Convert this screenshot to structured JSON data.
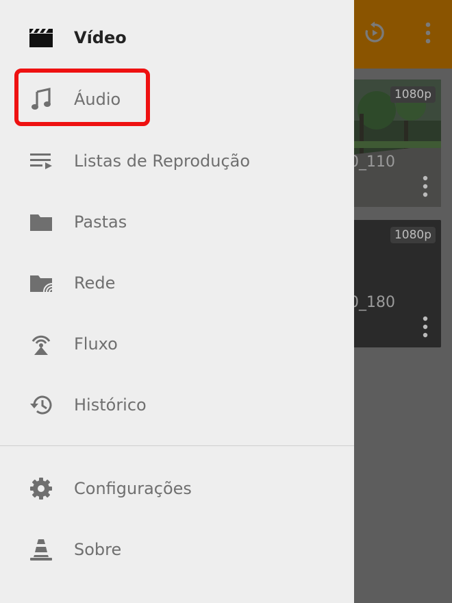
{
  "drawer": {
    "items": [
      {
        "label": "Vídeo",
        "icon": "clapperboard-icon"
      },
      {
        "label": "Áudio",
        "icon": "music-note-icon"
      },
      {
        "label": "Listas de Reprodução",
        "icon": "playlist-icon"
      },
      {
        "label": "Pastas",
        "icon": "folder-icon"
      },
      {
        "label": "Rede",
        "icon": "network-folder-icon"
      },
      {
        "label": "Fluxo",
        "icon": "stream-antenna-icon"
      },
      {
        "label": "Histórico",
        "icon": "history-icon"
      },
      {
        "label": "Configurações",
        "icon": "gear-icon"
      },
      {
        "label": "Sobre",
        "icon": "vlc-cone-icon"
      }
    ],
    "active_item": "Vídeo",
    "highlighted_item": "Áudio"
  },
  "background": {
    "appbar_color": "#8a5400",
    "cards": [
      {
        "resolution": "1080p",
        "filename_fragment": "0_110"
      },
      {
        "resolution": "1080p",
        "filename_fragment": "0_180"
      }
    ]
  },
  "colors": {
    "drawer_bg": "#eeeeee",
    "highlight": "#ee1111",
    "text_active": "#222222",
    "text_inactive": "#6f6f6f"
  }
}
